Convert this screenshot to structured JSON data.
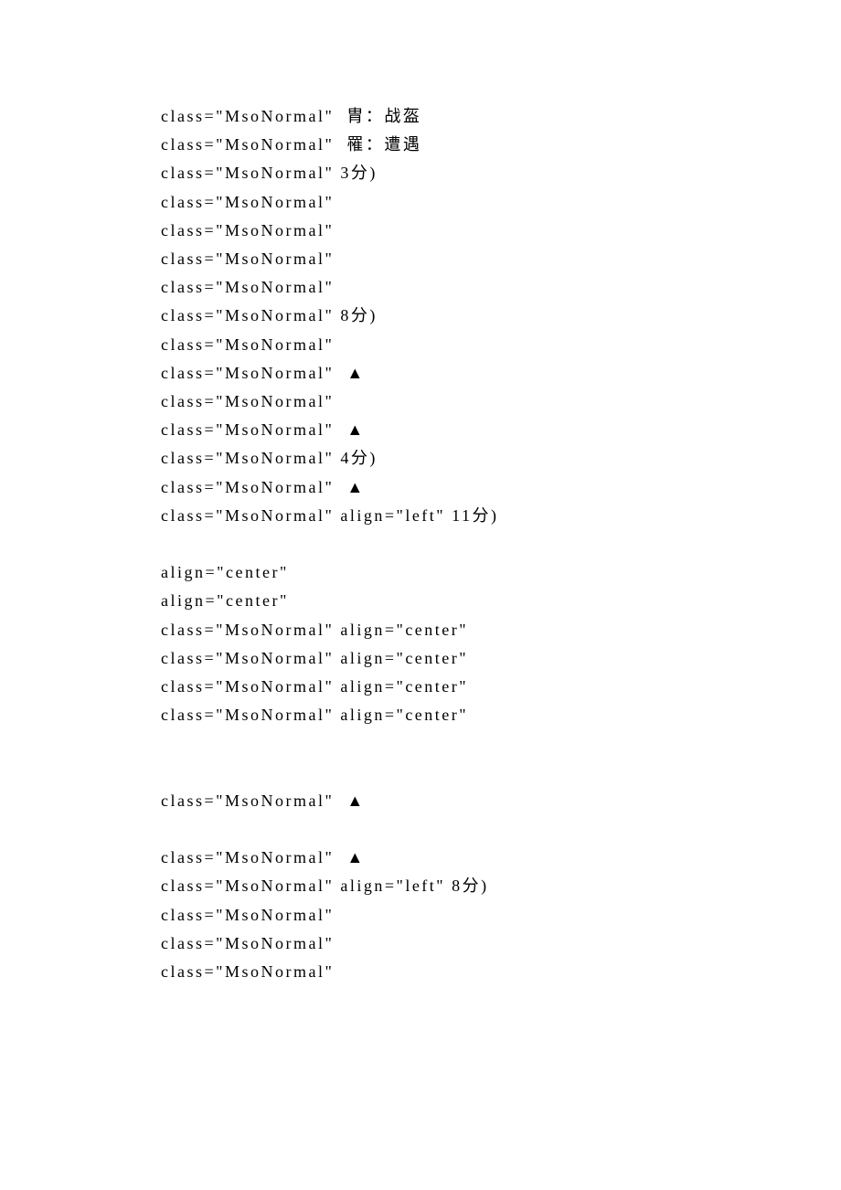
{
  "lines": [
    "class=\"MsoNormal\"  胄：战盔",
    "class=\"MsoNormal\"  罹：遭遇",
    "class=\"MsoNormal\" 3分)",
    "class=\"MsoNormal\"",
    "class=\"MsoNormal\"",
    "class=\"MsoNormal\"",
    "class=\"MsoNormal\"",
    "class=\"MsoNormal\" 8分)",
    "class=\"MsoNormal\"",
    "class=\"MsoNormal\"  ▲",
    "class=\"MsoNormal\"",
    "class=\"MsoNormal\"  ▲",
    "class=\"MsoNormal\" 4分)",
    "class=\"MsoNormal\"  ▲",
    "class=\"MsoNormal\" align=\"left\" 11分)",
    "",
    "align=\"center\"",
    "align=\"center\"",
    "class=\"MsoNormal\" align=\"center\"",
    "class=\"MsoNormal\" align=\"center\"",
    "class=\"MsoNormal\" align=\"center\"",
    "class=\"MsoNormal\" align=\"center\"",
    "",
    "",
    "class=\"MsoNormal\"  ▲",
    "",
    "class=\"MsoNormal\"  ▲",
    "class=\"MsoNormal\" align=\"left\" 8分)",
    "class=\"MsoNormal\"",
    "class=\"MsoNormal\"",
    "class=\"MsoNormal\""
  ]
}
